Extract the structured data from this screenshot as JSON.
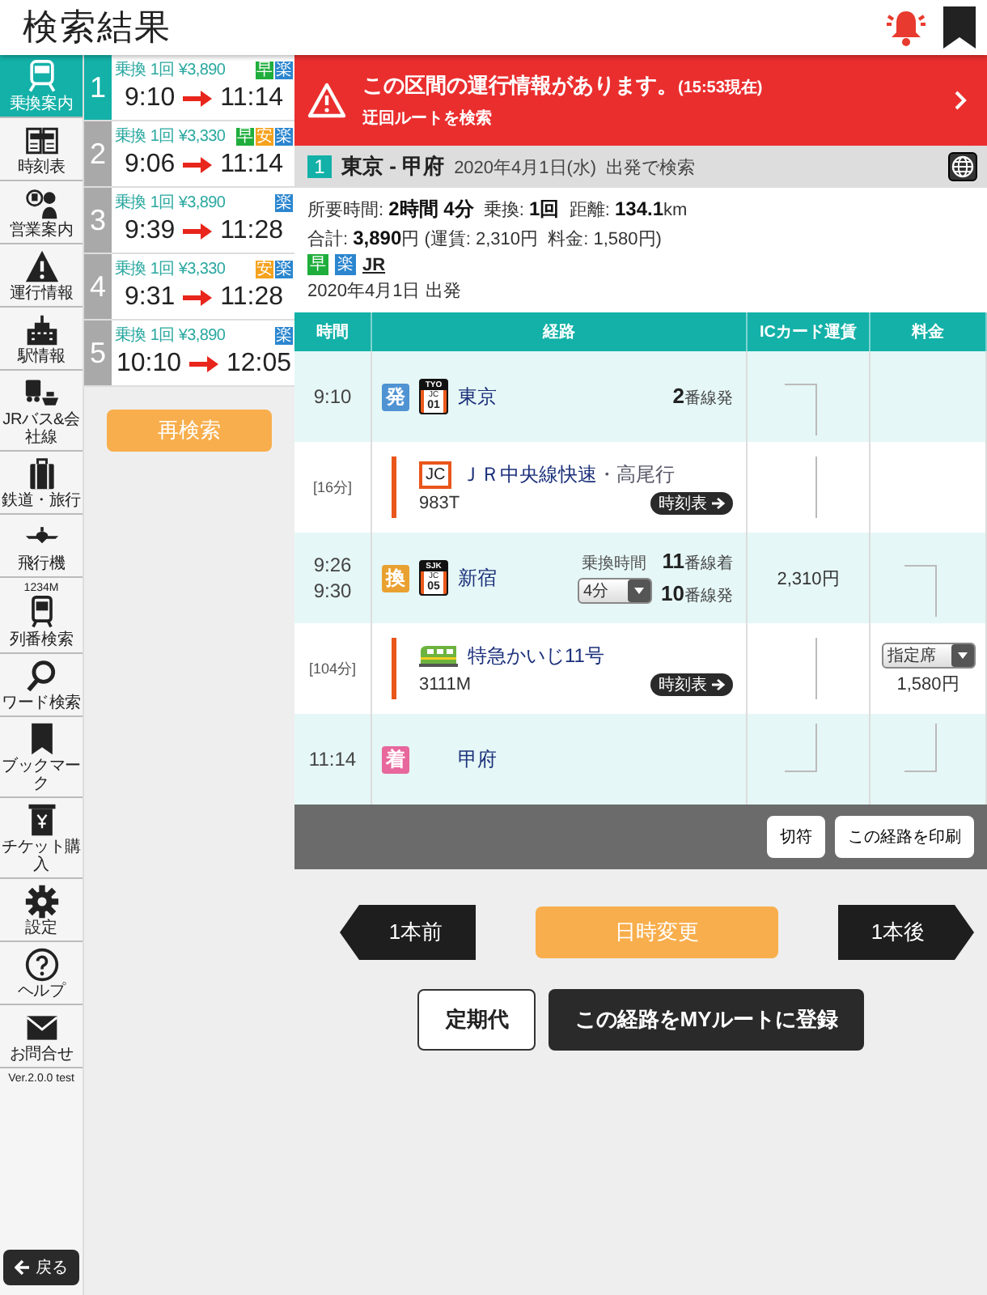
{
  "header": {
    "title": "検索結果"
  },
  "nav": {
    "items": [
      {
        "label": "乗換案内",
        "selected": true
      },
      {
        "label": "時刻表",
        "selected": false
      },
      {
        "label": "営業案内",
        "selected": false
      },
      {
        "label": "運行情報",
        "selected": false
      },
      {
        "label": "駅情報",
        "selected": false
      },
      {
        "label": "JRバス&会社線",
        "selected": false
      },
      {
        "label": "鉄道・旅行",
        "selected": false
      },
      {
        "label": "飛行機",
        "selected": false
      },
      {
        "label": "列番検索",
        "caption": "1234M",
        "selected": false
      },
      {
        "label": "ワード検索",
        "selected": false
      },
      {
        "label": "ブックマーク",
        "selected": false
      },
      {
        "label": "チケット購入",
        "selected": false
      },
      {
        "label": "設定",
        "selected": false
      },
      {
        "label": "ヘルプ",
        "selected": false
      },
      {
        "label": "お問合せ",
        "selected": false
      }
    ],
    "version": "Ver.2.0.0 test",
    "back_button": "戻る"
  },
  "routes": [
    {
      "number": "1",
      "summary": "乗換 1回 ¥3,890",
      "badges": [
        {
          "text": "早",
          "color": "#1fae3c"
        },
        {
          "text": "楽",
          "color": "#2b86cf"
        }
      ],
      "depart": "9:10",
      "arrive": "11:14",
      "selected": true
    },
    {
      "number": "2",
      "summary": "乗換 1回 ¥3,330",
      "badges": [
        {
          "text": "早",
          "color": "#1fae3c"
        },
        {
          "text": "安",
          "color": "#f5a21c"
        },
        {
          "text": "楽",
          "color": "#2b86cf"
        }
      ],
      "depart": "9:06",
      "arrive": "11:14",
      "selected": false
    },
    {
      "number": "3",
      "summary": "乗換 1回 ¥3,890",
      "badges": [
        {
          "text": "楽",
          "color": "#2b86cf"
        }
      ],
      "depart": "9:39",
      "arrive": "11:28",
      "selected": false
    },
    {
      "number": "4",
      "summary": "乗換 1回 ¥3,330",
      "badges": [
        {
          "text": "安",
          "color": "#f5a21c"
        },
        {
          "text": "楽",
          "color": "#2b86cf"
        }
      ],
      "depart": "9:31",
      "arrive": "11:28",
      "selected": false
    },
    {
      "number": "5",
      "summary": "乗換 1回 ¥3,890",
      "badges": [
        {
          "text": "楽",
          "color": "#2b86cf"
        }
      ],
      "depart": "10:10",
      "arrive": "12:05",
      "selected": false
    }
  ],
  "research_button": "再検索",
  "alert": {
    "title": "この区間の運行情報があります。",
    "time": "(15:53現在)",
    "link": "迂回ルートを検索"
  },
  "route_header": {
    "number": "1",
    "title": "東京 - 甲府",
    "date": "2020年4月1日(水)",
    "mode": "出発で検索"
  },
  "summary": {
    "lines": [
      "所要時間: **2時間 4分**  乗換: **1回**  距離: **134.1**km",
      "合計: **3,890**円 (運賃: 2,310円  料金: 1,580円)"
    ],
    "badges": [
      {
        "text": "早",
        "color": "#1fae3c"
      },
      {
        "text": "楽",
        "color": "#2b86cf"
      }
    ],
    "operator": "JR",
    "departure": "2020年4月1日 出発"
  },
  "table": {
    "columns": [
      "時間",
      "経路",
      "ICカード運賃",
      "料金"
    ],
    "rows": [
      {
        "kind": "station",
        "times": [
          "9:10"
        ],
        "mark": {
          "text": "発",
          "color": "#4f93d2"
        },
        "code": {
          "top": "TYO",
          "line": "JC",
          "num": "01"
        },
        "name": "東京",
        "platforms": [
          {
            "number": "2",
            "label": "番線発"
          }
        ],
        "ic": {
          "kind": "bracket_top"
        }
      },
      {
        "kind": "segment",
        "duration": "[16分]",
        "color": "#e9561b",
        "line_badge": "JC",
        "name": "ＪＲ中央線快速",
        "destination": "・高尾行",
        "train_number": "983T",
        "timetable_button": "時刻表",
        "ic": {
          "kind": "bracket_mid"
        }
      },
      {
        "kind": "station",
        "times": [
          "9:26",
          "9:30"
        ],
        "mark": {
          "text": "換",
          "color": "#e9a131"
        },
        "code": {
          "top": "SJK",
          "line": "JC",
          "num": "05"
        },
        "name": "新宿",
        "transfer": {
          "label": "乗換時間",
          "value": "4分"
        },
        "platforms": [
          {
            "number": "11",
            "label": "番線着"
          },
          {
            "number": "10",
            "label": "番線発"
          }
        ],
        "ic": {
          "kind": "amount",
          "text": "2,310円"
        },
        "fee": {
          "kind": "bracket_top"
        }
      },
      {
        "kind": "segment",
        "duration": "[104分]",
        "color": "#e9561b",
        "name": "特急かいじ11号",
        "train_number": "3111M",
        "timetable_button": "時刻表",
        "ic": {
          "kind": "bracket_mid"
        },
        "fee": {
          "kind": "select",
          "value": "指定席",
          "amount": "1,580円"
        }
      },
      {
        "kind": "station",
        "times": [
          "11:14"
        ],
        "mark": {
          "text": "着",
          "color": "#e8679c"
        },
        "name": "甲府",
        "ic": {
          "kind": "bracket_bottom"
        },
        "fee": {
          "kind": "bracket_bottom"
        }
      }
    ]
  },
  "toolbar": [
    "切符",
    "この経路を印刷"
  ],
  "navigation": {
    "previous": "1本前",
    "change": "日時変更",
    "next": "1本後"
  },
  "actions": [
    "定期代",
    "この経路をMYルートに登録"
  ]
}
